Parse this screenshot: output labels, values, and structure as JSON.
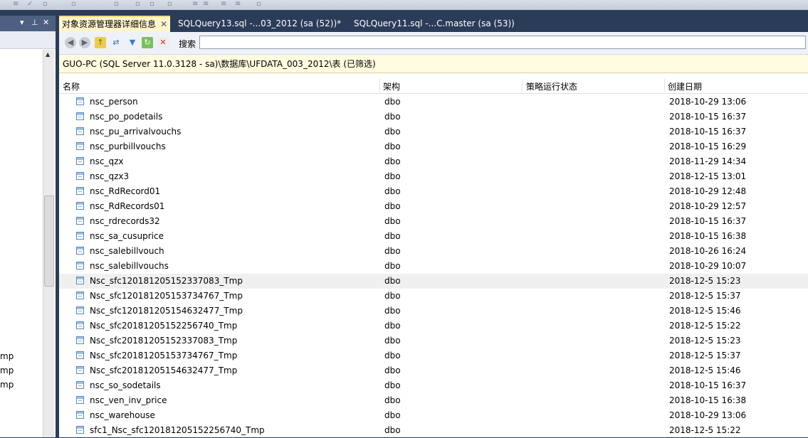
{
  "tabs": [
    {
      "label": "对象资源管理器详细信息",
      "active": true
    },
    {
      "label": "SQLQuery13.sql -...03_2012 (sa (52))*",
      "active": false
    },
    {
      "label": "SQLQuery11.sql -...C.master (sa (53))",
      "active": false
    }
  ],
  "left_panel": {
    "header_icons": [
      "pin-icon",
      "close-icon"
    ],
    "partial_items": [
      "mp",
      "mp",
      "mp"
    ]
  },
  "toolbar": {
    "search_label": "搜索",
    "search_value": "",
    "icons": [
      "back-icon",
      "forward-icon",
      "up-folder-icon",
      "sync-icon",
      "filter-icon",
      "refresh-icon",
      "stop-icon"
    ]
  },
  "path": "GUO-PC (SQL Server 11.0.3128 - sa)\\数据库\\UFDATA_003_2012\\表 (已筛选)",
  "columns": {
    "name": "名称",
    "schema": "架构",
    "policy": "策略运行状态",
    "created": "创建日期"
  },
  "rows": [
    {
      "name": "nsc_person",
      "schema": "dbo",
      "created": "2018-10-29 13:06"
    },
    {
      "name": "nsc_po_podetails",
      "schema": "dbo",
      "created": "2018-10-15 16:37"
    },
    {
      "name": "nsc_pu_arrivalvouchs",
      "schema": "dbo",
      "created": "2018-10-15 16:37"
    },
    {
      "name": "nsc_purbillvouchs",
      "schema": "dbo",
      "created": "2018-10-15 16:29"
    },
    {
      "name": "nsc_qzx",
      "schema": "dbo",
      "created": "2018-11-29 14:34"
    },
    {
      "name": "nsc_qzx3",
      "schema": "dbo",
      "created": "2018-12-15 13:01"
    },
    {
      "name": "nsc_RdRecord01",
      "schema": "dbo",
      "created": "2018-10-29 12:48"
    },
    {
      "name": "nsc_RdRecords01",
      "schema": "dbo",
      "created": "2018-10-29 12:57"
    },
    {
      "name": "nsc_rdrecords32",
      "schema": "dbo",
      "created": "2018-10-15 16:37"
    },
    {
      "name": "nsc_sa_cusuprice",
      "schema": "dbo",
      "created": "2018-10-15 16:38"
    },
    {
      "name": "nsc_salebillvouch",
      "schema": "dbo",
      "created": "2018-10-26 16:24"
    },
    {
      "name": "nsc_salebillvouchs",
      "schema": "dbo",
      "created": "2018-10-29 10:07"
    },
    {
      "name": "Nsc_sfc120181205152337083_Tmp",
      "schema": "dbo",
      "created": "2018-12-5 15:23"
    },
    {
      "name": "Nsc_sfc120181205153734767_Tmp",
      "schema": "dbo",
      "created": "2018-12-5 15:37"
    },
    {
      "name": "Nsc_sfc120181205154632477_Tmp",
      "schema": "dbo",
      "created": "2018-12-5 15:46"
    },
    {
      "name": "Nsc_sfc20181205152256740_Tmp",
      "schema": "dbo",
      "created": "2018-12-5 15:22"
    },
    {
      "name": "Nsc_sfc20181205152337083_Tmp",
      "schema": "dbo",
      "created": "2018-12-5 15:23"
    },
    {
      "name": "Nsc_sfc20181205153734767_Tmp",
      "schema": "dbo",
      "created": "2018-12-5 15:37"
    },
    {
      "name": "Nsc_sfc20181205154632477_Tmp",
      "schema": "dbo",
      "created": "2018-12-5 15:46"
    },
    {
      "name": "nsc_so_sodetails",
      "schema": "dbo",
      "created": "2018-10-15 16:37"
    },
    {
      "name": "nsc_ven_inv_price",
      "schema": "dbo",
      "created": "2018-10-15 16:38"
    },
    {
      "name": "nsc_warehouse",
      "schema": "dbo",
      "created": "2018-10-29 13:06"
    },
    {
      "name": "sfc1_Nsc_sfc120181205152256740_Tmp",
      "schema": "dbo",
      "created": "2018-12-5 15:22"
    }
  ],
  "selected_row_index": 12
}
